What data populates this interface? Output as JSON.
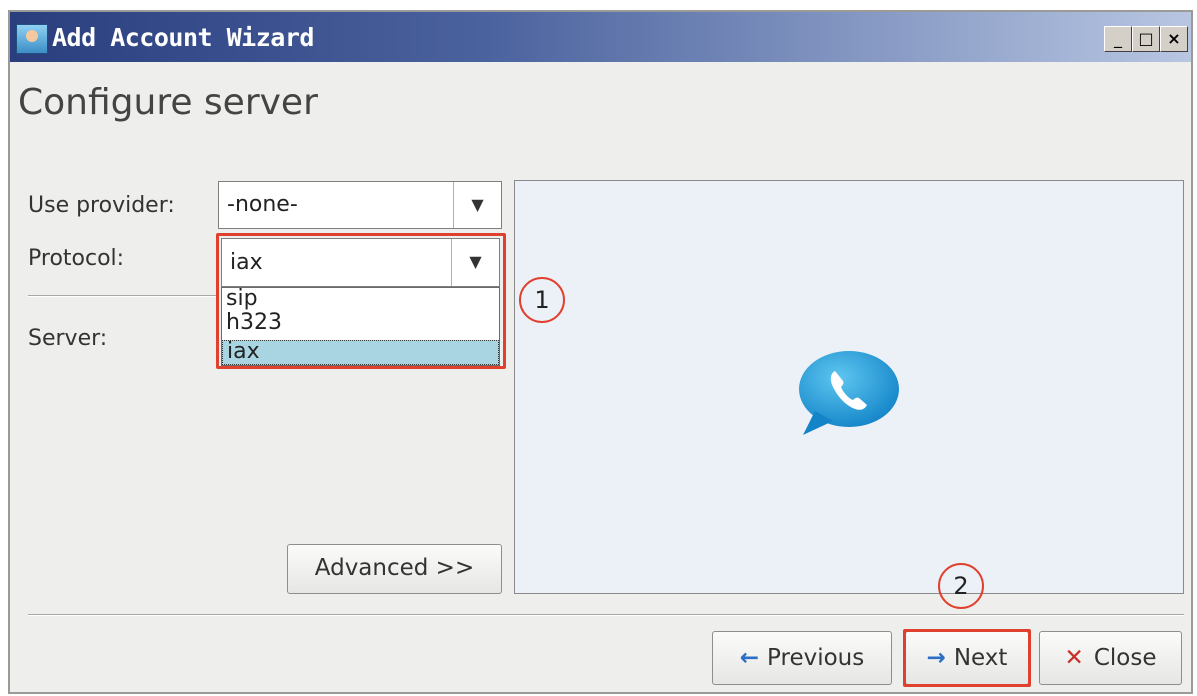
{
  "window": {
    "title": "Add Account Wizard",
    "controls": {
      "minimize": "_",
      "maximize": "□",
      "close": "×"
    }
  },
  "page": {
    "heading": "Configure server"
  },
  "form": {
    "provider_label": "Use provider:",
    "provider_value": "-none-",
    "protocol_label": "Protocol:",
    "protocol_value": "iax",
    "protocol_options": [
      "sip",
      "h323",
      "iax"
    ],
    "protocol_selected": "iax",
    "server_label": "Server:",
    "advanced_label": "Advanced >>"
  },
  "image_panel": {
    "icon": "phone-chat-bubble-icon",
    "accent": "#1e9ad6"
  },
  "buttons": {
    "previous": "Previous",
    "next": "Next",
    "close": "Close"
  },
  "annotations": {
    "step1": "1",
    "step2": "2",
    "highlight_color": "#e0402e"
  }
}
